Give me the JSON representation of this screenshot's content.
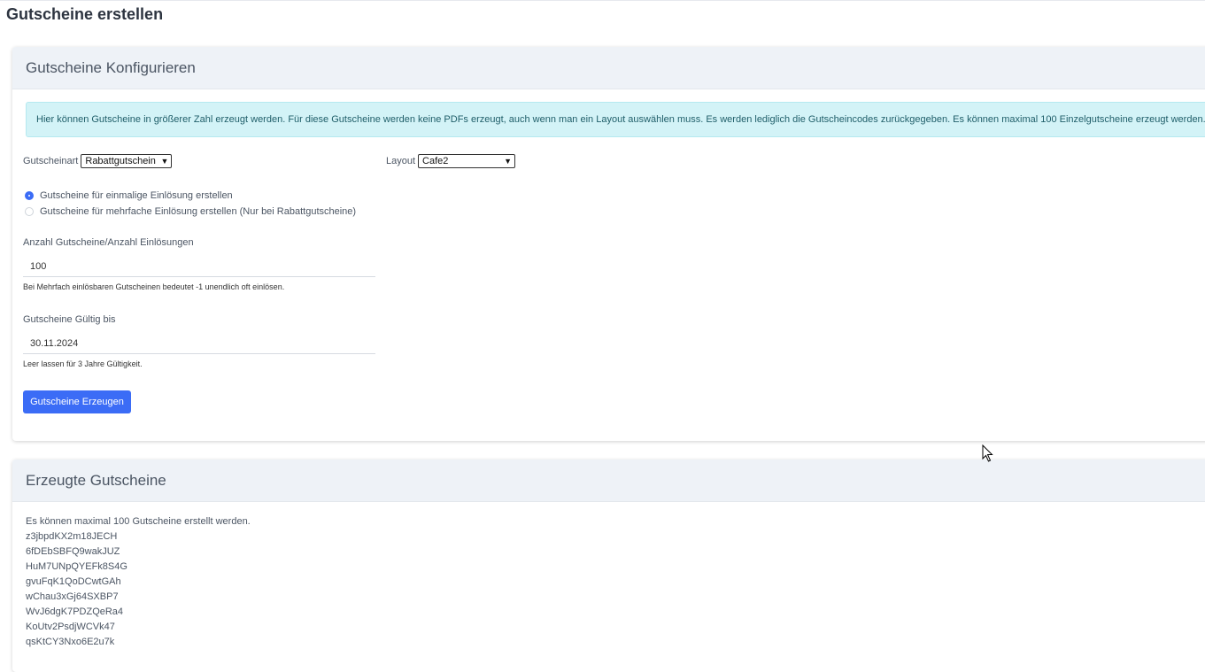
{
  "page": {
    "title": "Gutscheine erstellen"
  },
  "config_card": {
    "title": "Gutscheine Konfigurieren",
    "info": "Hier können Gutscheine in größerer Zahl erzeugt werden. Für diese Gutscheine werden keine PDFs erzeugt, auch wenn man ein Layout auswählen muss. Es werden lediglich die Gutscheincodes zurückgegeben. Es können maximal 100 Einzelgutscheine erzeugt werden.",
    "voucher_type": {
      "label": "Gutscheinart",
      "value": "Rabattgutschein"
    },
    "layout": {
      "label": "Layout",
      "value": "Cafe2"
    },
    "radio_single": {
      "label": "Gutscheine für einmalige Einlösung erstellen",
      "checked": true
    },
    "radio_multi": {
      "label": "Gutscheine für mehrfache Einlösung erstellen (Nur bei Rabattgutscheine)",
      "checked": false
    },
    "count": {
      "label": "Anzahl Gutscheine/Anzahl Einlösungen",
      "value": "100",
      "hint": "Bei Mehrfach einlösbaren Gutscheinen bedeutet -1 unendlich oft einlösen."
    },
    "valid_until": {
      "label": "Gutscheine Gültig bis",
      "value": "30.11.2024",
      "hint": "Leer lassen für 3 Jahre Gültigkeit."
    },
    "submit_label": "Gutscheine Erzeugen"
  },
  "result_card": {
    "title": "Erzeugte Gutscheine",
    "note": "Es können maximal 100 Gutscheine erstellt werden.",
    "codes": [
      "z3jbpdKX2m18JECH",
      "6fDEbSBFQ9wakJUZ",
      "HuM7UNpQYEFk8S4G",
      "gvuFqK1QoDCwtGAh",
      "wChau3xGj64SXBP7",
      "WvJ6dgK7PDZQeRa4",
      "KoUtv2PsdjWCVk47",
      "qsKtCY3Nxo6E2u7k"
    ]
  },
  "colors": {
    "primary": "#3b6cf6",
    "info_bg": "#d3f3f7",
    "card_header_bg": "#eef2f7"
  }
}
